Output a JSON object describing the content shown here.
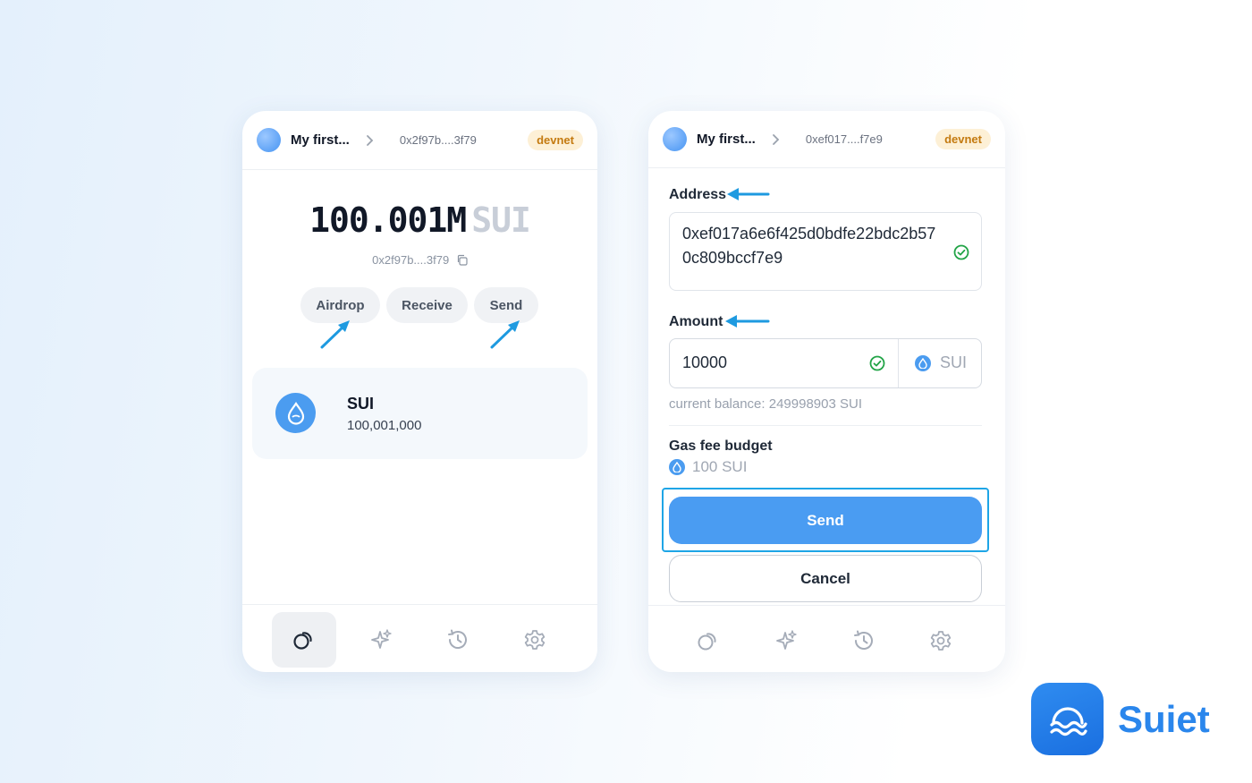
{
  "left_panel": {
    "header": {
      "wallet_name": "My first...",
      "address": "0x2f97b....3f79",
      "network": "devnet"
    },
    "balance": {
      "amount": "100.001M",
      "unit": "SUI"
    },
    "sub_address": "0x2f97b....3f79",
    "actions": {
      "airdrop": "Airdrop",
      "receive": "Receive",
      "send": "Send"
    },
    "token": {
      "name": "SUI",
      "amount": "100,001,000"
    },
    "nav": {
      "items": [
        "coins-icon",
        "sparkles-icon",
        "history-icon",
        "settings-icon"
      ],
      "active": "coins-icon"
    }
  },
  "right_panel": {
    "header": {
      "wallet_name": "My first...",
      "address": "0xef017....f7e9",
      "network": "devnet"
    },
    "address_label": "Address",
    "address_value": "0xef017a6e6f425d0bdfe22bdc2b570c809bccf7e9",
    "amount_label": "Amount",
    "amount_value": "10000",
    "amount_unit": "SUI",
    "current_balance": "current balance: 249998903 SUI",
    "gas_label": "Gas fee budget",
    "gas_value": "100 SUI",
    "send_label": "Send",
    "cancel_label": "Cancel"
  },
  "brand": {
    "name": "Suiet"
  },
  "colors": {
    "accent": "#4a9cf2",
    "highlight": "#1ea5e6",
    "devnet_badge_bg": "#fdf0d6",
    "devnet_badge_text": "#c47a10",
    "success": "#22a447"
  }
}
